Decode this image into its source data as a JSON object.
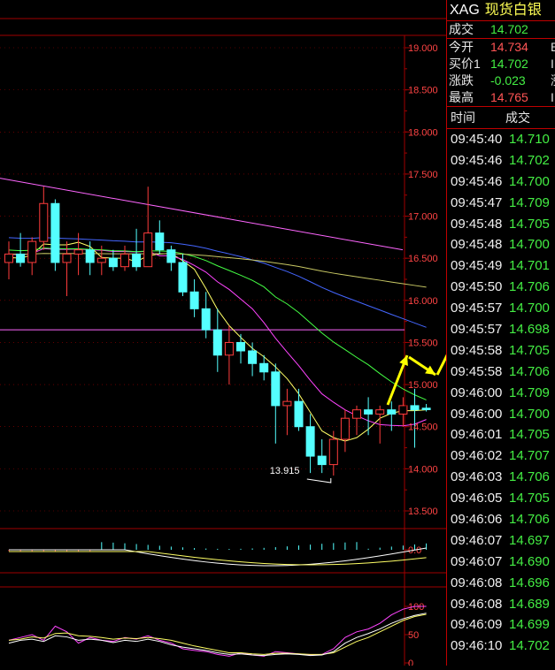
{
  "quote": {
    "symbol": "XAG",
    "name": "现货白银",
    "rows": [
      {
        "label": "成交",
        "value": "14.702",
        "color": "green",
        "cut": ""
      },
      {
        "label": "今开",
        "value": "14.734",
        "color": "red",
        "cut": "B"
      },
      {
        "label": "买价1",
        "value": "14.702",
        "color": "green",
        "cut": "I"
      },
      {
        "label": "涨跌",
        "value": "-0.023",
        "color": "green",
        "cut": "涨"
      },
      {
        "label": "最高",
        "value": "14.765",
        "color": "red",
        "cut": "I"
      }
    ]
  },
  "ticks": {
    "header_time": "时间",
    "header_price": "成交",
    "rows": [
      {
        "time": "09:45:40",
        "price": "14.710"
      },
      {
        "time": "09:45:46",
        "price": "14.702"
      },
      {
        "time": "09:45:46",
        "price": "14.700"
      },
      {
        "time": "09:45:47",
        "price": "14.709"
      },
      {
        "time": "09:45:48",
        "price": "14.705"
      },
      {
        "time": "09:45:48",
        "price": "14.700"
      },
      {
        "time": "09:45:49",
        "price": "14.701"
      },
      {
        "time": "09:45:50",
        "price": "14.706"
      },
      {
        "time": "09:45:57",
        "price": "14.700"
      },
      {
        "time": "09:45:57",
        "price": "14.698"
      },
      {
        "time": "09:45:58",
        "price": "14.705"
      },
      {
        "time": "09:45:58",
        "price": "14.706"
      },
      {
        "time": "09:46:00",
        "price": "14.709"
      },
      {
        "time": "09:46:00",
        "price": "14.700"
      },
      {
        "time": "09:46:01",
        "price": "14.705"
      },
      {
        "time": "09:46:02",
        "price": "14.707"
      },
      {
        "time": "09:46:03",
        "price": "14.706"
      },
      {
        "time": "09:46:05",
        "price": "14.705"
      },
      {
        "time": "09:46:06",
        "price": "14.706"
      },
      {
        "time": "09:46:07",
        "price": "14.697"
      },
      {
        "time": "09:46:07",
        "price": "14.690"
      },
      {
        "time": "09:46:08",
        "price": "14.696"
      },
      {
        "time": "09:46:08",
        "price": "14.689"
      },
      {
        "time": "09:46:09",
        "price": "14.699"
      },
      {
        "time": "09:46:10",
        "price": "14.702"
      }
    ]
  },
  "price_axis": {
    "labels": [
      "19.000",
      "18.500",
      "18.000",
      "17.500",
      "17.000",
      "16.500",
      "16.000",
      "15.500",
      "15.000",
      "14.500",
      "14.000",
      "13.500"
    ],
    "min": 13.5,
    "max": 19.0
  },
  "low_annotation": "13.915",
  "macd_axis": {
    "labels": [
      "0.0"
    ]
  },
  "kdj_axis": {
    "labels": [
      "100",
      "50",
      "0"
    ]
  },
  "colors": {
    "up": "#ff3c3c",
    "down": "#54ffff",
    "ma5": "#ffffff",
    "ma10": "#ffff66",
    "ma20": "#ff44ff",
    "ma30": "#44ff44",
    "ma60": "#4466ff",
    "ma120": "#c8c864",
    "trend": "#ff66ff",
    "arrow": "#ffff00",
    "grid": "#a00000"
  },
  "chart_data": {
    "type": "candlestick",
    "ylim": [
      13.5,
      19.0
    ],
    "candles": [
      {
        "o": 16.45,
        "h": 16.7,
        "l": 16.25,
        "c": 16.55
      },
      {
        "o": 16.55,
        "h": 16.8,
        "l": 16.4,
        "c": 16.45
      },
      {
        "o": 16.45,
        "h": 16.75,
        "l": 16.3,
        "c": 16.7
      },
      {
        "o": 16.7,
        "h": 17.35,
        "l": 16.6,
        "c": 17.15
      },
      {
        "o": 17.15,
        "h": 17.2,
        "l": 16.35,
        "c": 16.45
      },
      {
        "o": 16.45,
        "h": 16.7,
        "l": 16.05,
        "c": 16.55
      },
      {
        "o": 16.55,
        "h": 16.8,
        "l": 16.3,
        "c": 16.6
      },
      {
        "o": 16.6,
        "h": 16.7,
        "l": 16.3,
        "c": 16.45
      },
      {
        "o": 16.45,
        "h": 16.65,
        "l": 16.3,
        "c": 16.5
      },
      {
        "o": 16.5,
        "h": 16.6,
        "l": 16.35,
        "c": 16.4
      },
      {
        "o": 16.4,
        "h": 16.65,
        "l": 16.35,
        "c": 16.55
      },
      {
        "o": 16.55,
        "h": 16.85,
        "l": 16.35,
        "c": 16.4
      },
      {
        "o": 16.4,
        "h": 17.35,
        "l": 16.4,
        "c": 16.8
      },
      {
        "o": 16.8,
        "h": 16.95,
        "l": 16.55,
        "c": 16.6
      },
      {
        "o": 16.6,
        "h": 16.65,
        "l": 16.35,
        "c": 16.45
      },
      {
        "o": 16.45,
        "h": 16.55,
        "l": 16.05,
        "c": 16.1
      },
      {
        "o": 16.1,
        "h": 16.25,
        "l": 15.8,
        "c": 15.9
      },
      {
        "o": 15.9,
        "h": 16.1,
        "l": 15.55,
        "c": 15.65
      },
      {
        "o": 15.65,
        "h": 15.9,
        "l": 15.15,
        "c": 15.35
      },
      {
        "o": 15.35,
        "h": 15.7,
        "l": 15.0,
        "c": 15.5
      },
      {
        "o": 15.5,
        "h": 15.6,
        "l": 15.25,
        "c": 15.4
      },
      {
        "o": 15.4,
        "h": 15.5,
        "l": 15.1,
        "c": 15.25
      },
      {
        "o": 15.25,
        "h": 15.35,
        "l": 15.05,
        "c": 15.15
      },
      {
        "o": 15.15,
        "h": 15.25,
        "l": 14.3,
        "c": 14.75
      },
      {
        "o": 14.75,
        "h": 14.95,
        "l": 14.4,
        "c": 14.8
      },
      {
        "o": 14.8,
        "h": 14.95,
        "l": 14.45,
        "c": 14.5
      },
      {
        "o": 14.5,
        "h": 14.65,
        "l": 13.95,
        "c": 14.15
      },
      {
        "o": 14.15,
        "h": 14.35,
        "l": 13.95,
        "c": 14.05
      },
      {
        "o": 14.05,
        "h": 14.45,
        "l": 13.92,
        "c": 14.35
      },
      {
        "o": 14.35,
        "h": 14.7,
        "l": 14.2,
        "c": 14.6
      },
      {
        "o": 14.6,
        "h": 14.75,
        "l": 14.4,
        "c": 14.7
      },
      {
        "o": 14.7,
        "h": 14.85,
        "l": 14.4,
        "c": 14.65
      },
      {
        "o": 14.65,
        "h": 14.75,
        "l": 14.3,
        "c": 14.7
      },
      {
        "o": 14.7,
        "h": 14.8,
        "l": 14.45,
        "c": 14.65
      },
      {
        "o": 14.65,
        "h": 14.85,
        "l": 14.5,
        "c": 14.75
      },
      {
        "o": 14.75,
        "h": 14.95,
        "l": 14.25,
        "c": 14.7
      },
      {
        "o": 14.72,
        "h": 14.77,
        "l": 14.68,
        "c": 14.702
      }
    ]
  }
}
